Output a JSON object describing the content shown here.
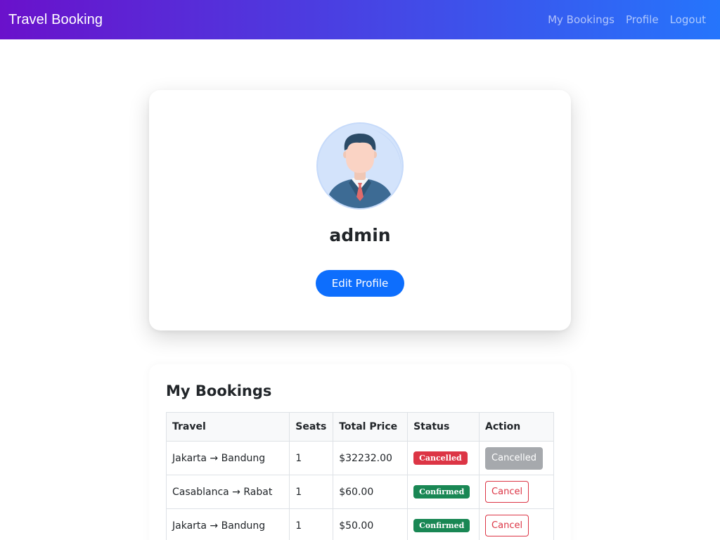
{
  "navbar": {
    "brand": "Travel Booking",
    "links": [
      "My Bookings",
      "Profile",
      "Logout"
    ]
  },
  "profile": {
    "username": "admin",
    "avatar_icon": "businessman-avatar-icon",
    "edit_label": "Edit Profile"
  },
  "bookings": {
    "title": "My Bookings",
    "columns": [
      "Travel",
      "Seats",
      "Total Price",
      "Status",
      "Action"
    ],
    "rows": [
      {
        "travel": "Jakarta → Bandung",
        "seats": "1",
        "price": "$32232.00",
        "status": "Cancelled",
        "action": "Cancelled"
      },
      {
        "travel": "Casablanca → Rabat",
        "seats": "1",
        "price": "$60.00",
        "status": "Confirmed",
        "action": "Cancel"
      },
      {
        "travel": "Jakarta → Bandung",
        "seats": "1",
        "price": "$50.00",
        "status": "Confirmed",
        "action": "Cancel"
      }
    ]
  },
  "colors": {
    "navbar_gradient_start": "#6a11cb",
    "navbar_gradient_end": "#2575fc",
    "primary": "#0d6efd",
    "danger": "#dc3545",
    "success": "#198754",
    "secondary_disabled": "#a6a9ad"
  }
}
